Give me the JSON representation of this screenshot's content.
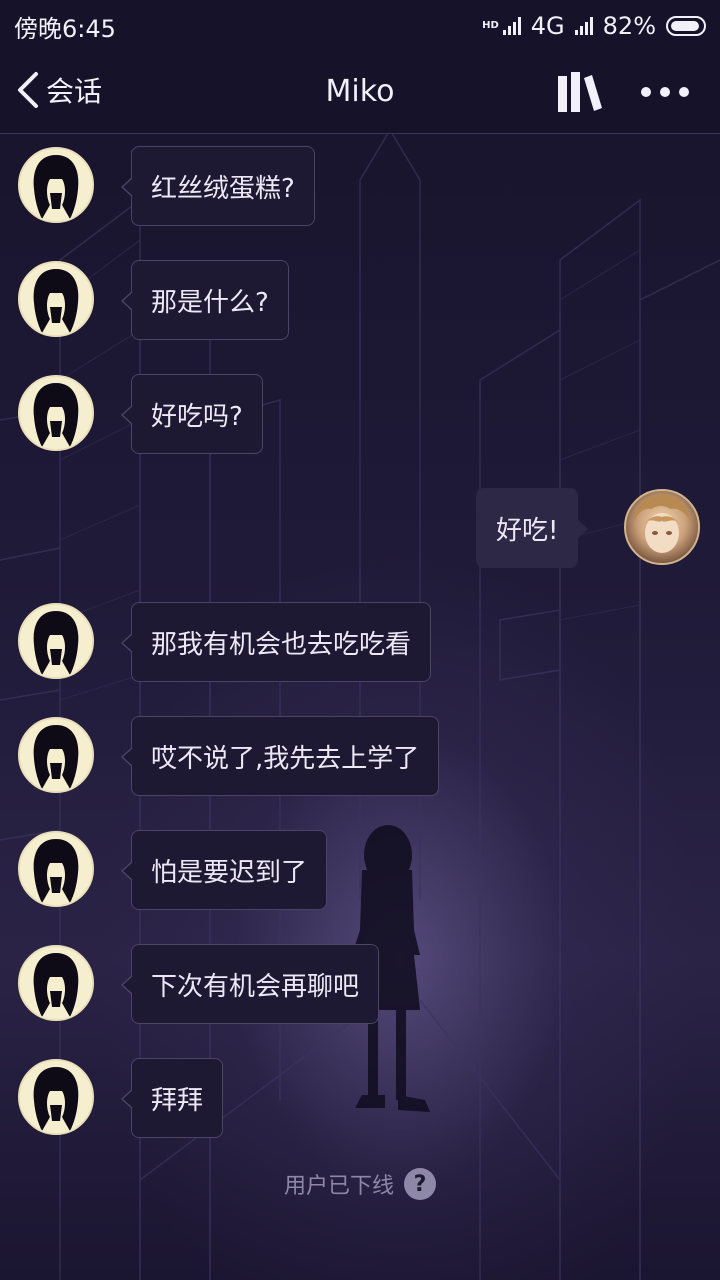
{
  "status_bar": {
    "time": "傍晚6:45",
    "hd_label": "HD",
    "network": "4G",
    "battery": "82%"
  },
  "header": {
    "back_label": "会话",
    "title": "Miko",
    "icons": [
      "chevron-left-icon",
      "books-icon",
      "more-icon"
    ]
  },
  "messages": [
    {
      "sender": "Miko",
      "side": "left",
      "text": "红丝绒蛋糕?"
    },
    {
      "sender": "Miko",
      "side": "left",
      "text": "那是什么?"
    },
    {
      "sender": "Miko",
      "side": "left",
      "text": "好吃吗?"
    },
    {
      "sender": "me",
      "side": "right",
      "text": "好吃!"
    },
    {
      "sender": "Miko",
      "side": "left",
      "text": "那我有机会也去吃吃看"
    },
    {
      "sender": "Miko",
      "side": "left",
      "text": "哎不说了,我先去上学了"
    },
    {
      "sender": "Miko",
      "side": "left",
      "text": "怕是要迟到了"
    },
    {
      "sender": "Miko",
      "side": "left",
      "text": "下次有机会再聊吧"
    },
    {
      "sender": "Miko",
      "side": "left",
      "text": "拜拜"
    }
  ],
  "footer": {
    "offline_text": "用户已下线",
    "help_glyph": "?"
  },
  "colors": {
    "background": "#1a1530",
    "bubble_left": "#1d1932",
    "bubble_right": "#2c2845",
    "text": "#ece8f6",
    "muted": "#8e88a8"
  }
}
